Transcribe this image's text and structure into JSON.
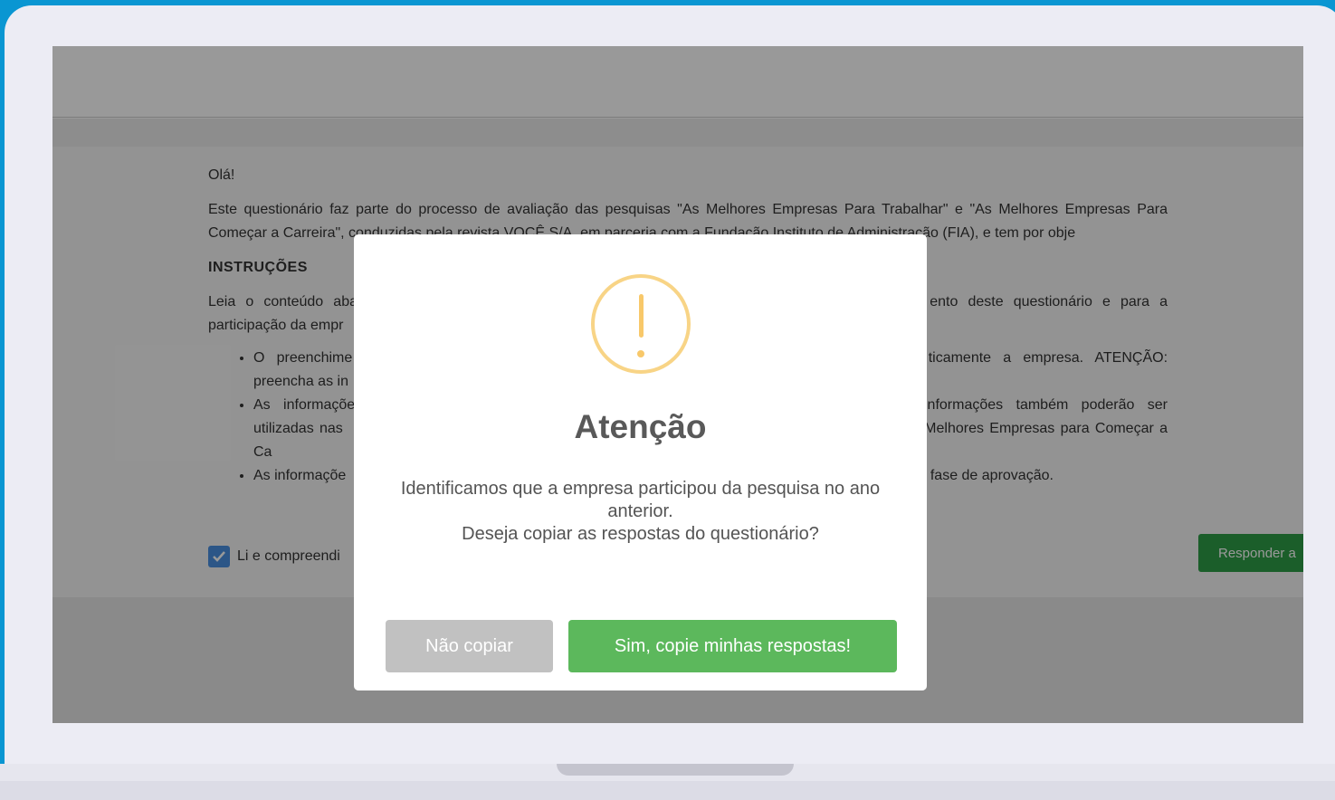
{
  "page": {
    "greeting": "Olá!",
    "intro": "Este questionário faz parte do processo de avaliação das pesquisas \"As Melhores Empresas Para Trabalhar\" e \"As Melhores Empresas Para Começar a Carreira\", conduzidas pela revista VOCÊ S/A, em parceria com a Fundação Instituto de Administração (FIA), e tem por obje",
    "instructions_title": "INSTRUÇÕES",
    "instructions_text_start": "Leia o conteúdo aba",
    "instructions_text_end": "ento deste questionário e para a participação da empr",
    "bullets": [
      {
        "start": "O preenchime",
        "end": "ticamente a empresa. ATENÇÃO: preencha as in"
      },
      {
        "start": "As informaçõe",
        "end": "informações também poderão ser utilizadas nas",
        "extra": "ar e As Melhores Empresas para Começar a Ca"
      },
      {
        "start": "As informaçõe",
        "end": "em fase de aprovação."
      }
    ],
    "agree_label": "Li e compreendi",
    "answer_button": "Responder a"
  },
  "modal": {
    "title": "Atenção",
    "message_line1": "Identificamos que a empresa participou da pesquisa no ano anterior.",
    "message_line2": "Deseja copiar as respostas do questionário?",
    "cancel_label": "Não copiar",
    "confirm_label": "Sim, copie minhas respostas!",
    "icon": "warning-icon",
    "icon_color": "#f8d486",
    "confirm_color": "#5cb85c",
    "cancel_color": "#c1c1c1"
  }
}
